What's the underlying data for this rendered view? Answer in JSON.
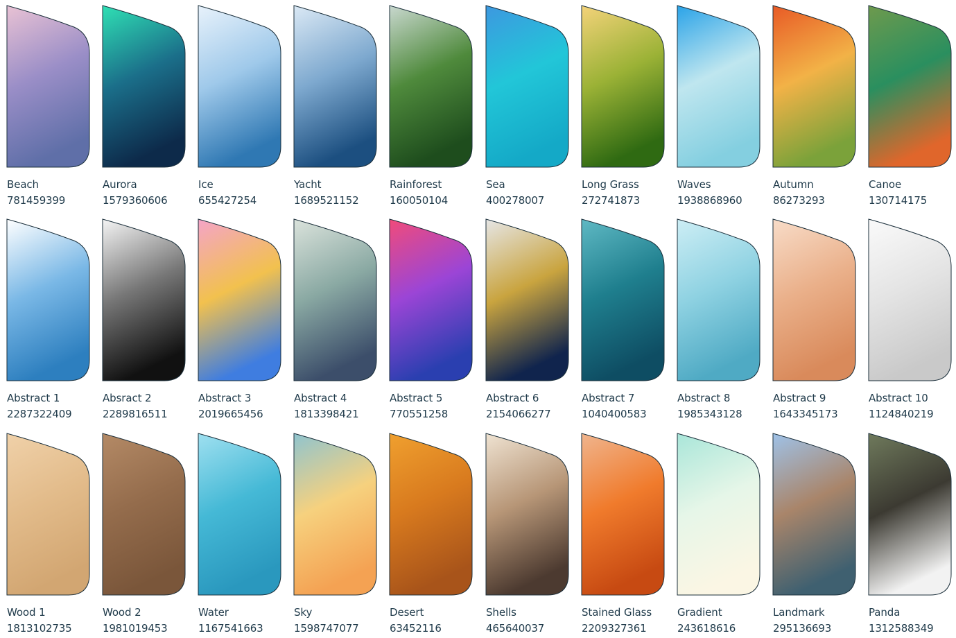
{
  "rows": [
    [
      {
        "name": "Beach",
        "code": "781459399",
        "colors": [
          "#e9c2d4",
          "#9a8ec7",
          "#5f6fa8"
        ]
      },
      {
        "name": "Aurora",
        "code": "1579360606",
        "colors": [
          "#2fe0b4",
          "#1b6f8a",
          "#0d2a4a"
        ]
      },
      {
        "name": "Ice",
        "code": "655427254",
        "colors": [
          "#e8f2fb",
          "#9fc9ea",
          "#2f78b3"
        ]
      },
      {
        "name": "Yacht",
        "code": "1689521152",
        "colors": [
          "#dbe9f5",
          "#7ea9cf",
          "#1c4f80"
        ]
      },
      {
        "name": "Rainforest",
        "code": "160050104",
        "colors": [
          "#c9d8cf",
          "#4f8a3c",
          "#1e4d1d"
        ]
      },
      {
        "name": "Sea",
        "code": "400278007",
        "colors": [
          "#3d98e0",
          "#22c6d8",
          "#14a9c7"
        ]
      },
      {
        "name": "Long Grass",
        "code": "272741873",
        "colors": [
          "#f4d37a",
          "#9bb236",
          "#2f6a12"
        ]
      },
      {
        "name": "Waves",
        "code": "1938868960",
        "colors": [
          "#2aa3e8",
          "#bfe6ef",
          "#84cfe0"
        ]
      },
      {
        "name": "Autumn",
        "code": "86273293",
        "colors": [
          "#e85a26",
          "#f2b247",
          "#7ba23a"
        ]
      },
      {
        "name": "Canoe",
        "code": "130714175",
        "colors": [
          "#6e9a4d",
          "#2a8f5f",
          "#e0662b"
        ]
      }
    ],
    [
      {
        "name": "Abstract 1",
        "code": "2287322409",
        "colors": [
          "#ffffff",
          "#7ab8e6",
          "#2d7fbf"
        ]
      },
      {
        "name": "Absract 2",
        "code": "2289816511",
        "colors": [
          "#f5f5f5",
          "#777777",
          "#111111"
        ]
      },
      {
        "name": "Abstract 3",
        "code": "2019665456",
        "colors": [
          "#f4a4c8",
          "#f2c14e",
          "#3f7de0"
        ]
      },
      {
        "name": "Abstract 4",
        "code": "1813398421",
        "colors": [
          "#dbe3dc",
          "#8aa9a3",
          "#3c4e6a"
        ]
      },
      {
        "name": "Abstract 5",
        "code": "770551258",
        "colors": [
          "#f14b7a",
          "#9b45d6",
          "#2a3fb0"
        ]
      },
      {
        "name": "Abstract 6",
        "code": "2154066277",
        "colors": [
          "#e6e6e6",
          "#c9a43f",
          "#10244d"
        ]
      },
      {
        "name": "Abstract 7",
        "code": "1040400583",
        "colors": [
          "#5fb9c4",
          "#1f7f8e",
          "#0e4d63"
        ]
      },
      {
        "name": "Abstract 8",
        "code": "1985343128",
        "colors": [
          "#cdeef5",
          "#8fd2e2",
          "#4faac4"
        ]
      },
      {
        "name": "Abstract 9",
        "code": "1643345173",
        "colors": [
          "#f8dcc8",
          "#eab08a",
          "#d98a5b"
        ]
      },
      {
        "name": "Abstract 10",
        "code": "1124840219",
        "colors": [
          "#fafafa",
          "#e4e4e4",
          "#c9c9c9"
        ]
      }
    ],
    [
      {
        "name": "Wood 1",
        "code": "1813102735",
        "colors": [
          "#f0d1a9",
          "#e2bb8a",
          "#d2a672"
        ]
      },
      {
        "name": "Wood 2",
        "code": "1981019453",
        "colors": [
          "#b48a66",
          "#946c4c",
          "#7a563a"
        ]
      },
      {
        "name": "Water",
        "code": "1167541663",
        "colors": [
          "#9fe0f0",
          "#45b9d6",
          "#2a98be"
        ]
      },
      {
        "name": "Sky",
        "code": "1598747077",
        "colors": [
          "#8fc4cf",
          "#f6d17e",
          "#f4a253"
        ]
      },
      {
        "name": "Desert",
        "code": "63452116",
        "colors": [
          "#f0a02f",
          "#d87a1e",
          "#a8541a"
        ]
      },
      {
        "name": "Shells",
        "code": "465640037",
        "colors": [
          "#efe3d2",
          "#b79677",
          "#4c3a30"
        ]
      },
      {
        "name": "Stained Glass",
        "code": "2209327361",
        "colors": [
          "#f0b58e",
          "#f07b2c",
          "#c74a12"
        ]
      },
      {
        "name": "Gradient",
        "code": "243618616",
        "colors": [
          "#a9e6d9",
          "#e6f6e8",
          "#fbf6e4"
        ]
      },
      {
        "name": "Landmark",
        "code": "295136693",
        "colors": [
          "#9fc2e8",
          "#a9856a",
          "#3f6070"
        ]
      },
      {
        "name": "Panda",
        "code": "1312588349",
        "colors": [
          "#6f7a5c",
          "#3c3a32",
          "#f2f2f2"
        ]
      }
    ]
  ],
  "style": {
    "text_color": "#1f3a4a",
    "outline_color": "#1a2e3a"
  }
}
